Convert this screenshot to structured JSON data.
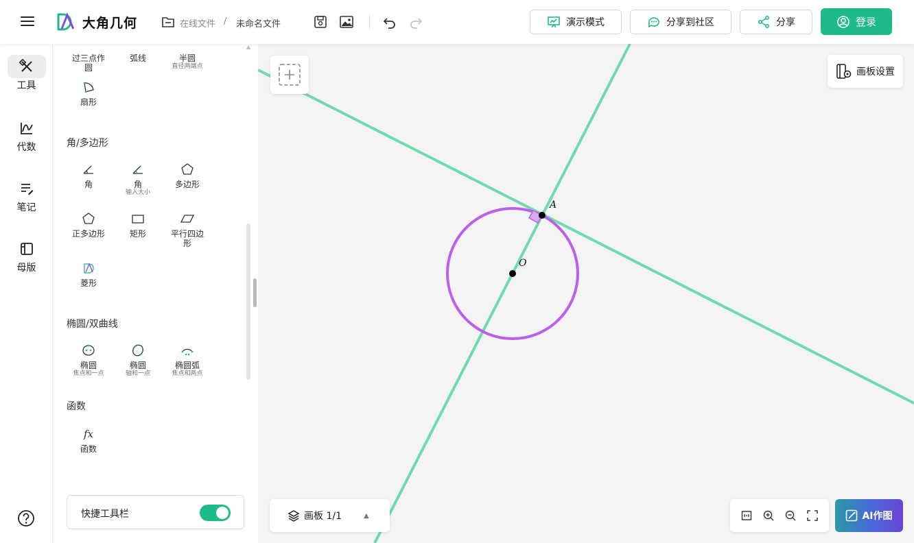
{
  "header": {
    "brand": "大角几何",
    "breadcrumb_online": "在线文件",
    "breadcrumb_sep": "/",
    "breadcrumb_file": "未命名文件",
    "present_label": "演示模式",
    "community_label": "分享到社区",
    "share_label": "分享",
    "login_label": "登录"
  },
  "rail": {
    "items": [
      {
        "label": "工具"
      },
      {
        "label": "代数"
      },
      {
        "label": "笔记"
      },
      {
        "label": "母版"
      }
    ]
  },
  "panel": {
    "top_tools": [
      {
        "label": "过三点作圆",
        "sub": ""
      },
      {
        "label": "弧线",
        "sub": ""
      },
      {
        "label": "半圆",
        "sub": "直径两端点"
      },
      {
        "label": "扇形",
        "sub": ""
      }
    ],
    "sections": {
      "angle_polygon": "角/多边形",
      "ellipse": "椭圆/双曲线",
      "function": "函数"
    },
    "angle_tools": [
      {
        "label": "角",
        "sub": ""
      },
      {
        "label": "角",
        "sub": "输入大小"
      },
      {
        "label": "多边形",
        "sub": ""
      },
      {
        "label": "正多边形",
        "sub": ""
      },
      {
        "label": "矩形",
        "sub": ""
      },
      {
        "label": "平行四边形",
        "sub": ""
      },
      {
        "label": "菱形",
        "sub": ""
      }
    ],
    "ellipse_tools": [
      {
        "label": "椭圆",
        "sub": "焦点和一点"
      },
      {
        "label": "椭圆",
        "sub": "轴和一点"
      },
      {
        "label": "椭圆弧",
        "sub": "焦点和两点"
      }
    ],
    "function_tools": [
      {
        "label": "函数",
        "icon_text": "fx"
      }
    ],
    "quick_toolbar_label": "快捷工具栏",
    "quick_toolbar_on": true
  },
  "canvas": {
    "board_settings_label": "画板设置",
    "boards_label": "画板 1/1",
    "ai_label": "AI作图",
    "points": [
      {
        "name": "A"
      },
      {
        "name": "O"
      }
    ],
    "colors": {
      "line": "#6ddbad",
      "circle": "#bd5fe8",
      "right_angle": "#d9a8f0",
      "accent": "#1dba8a"
    }
  }
}
